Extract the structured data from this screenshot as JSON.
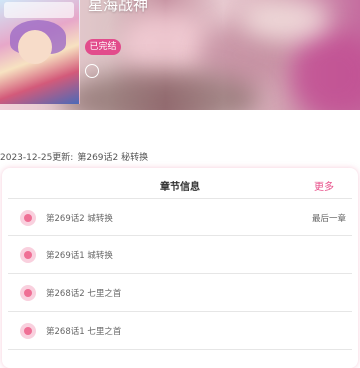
{
  "manga": {
    "title": "星海战神",
    "status": "已完结"
  },
  "update": {
    "date_label": "2023-12-25更新:",
    "latest_chapter": "第269话2 秘转换"
  },
  "chapters_card": {
    "title": "章节信息",
    "more_label": "更多",
    "latest_tag": "最后一章",
    "items": [
      {
        "name": "第269话2 城转换"
      },
      {
        "name": "第269话1 城转换"
      },
      {
        "name": "第268话2 七里之首"
      },
      {
        "name": "第268话1 七里之首"
      }
    ]
  },
  "colors": {
    "accent": "#e8508a",
    "badge": "#e24c8c",
    "dot": "#ef6f95"
  },
  "icons": {
    "cover": "manga-cover-image",
    "circle": "circle-outline-icon",
    "chapter_dot": "pink-dot-icon"
  }
}
